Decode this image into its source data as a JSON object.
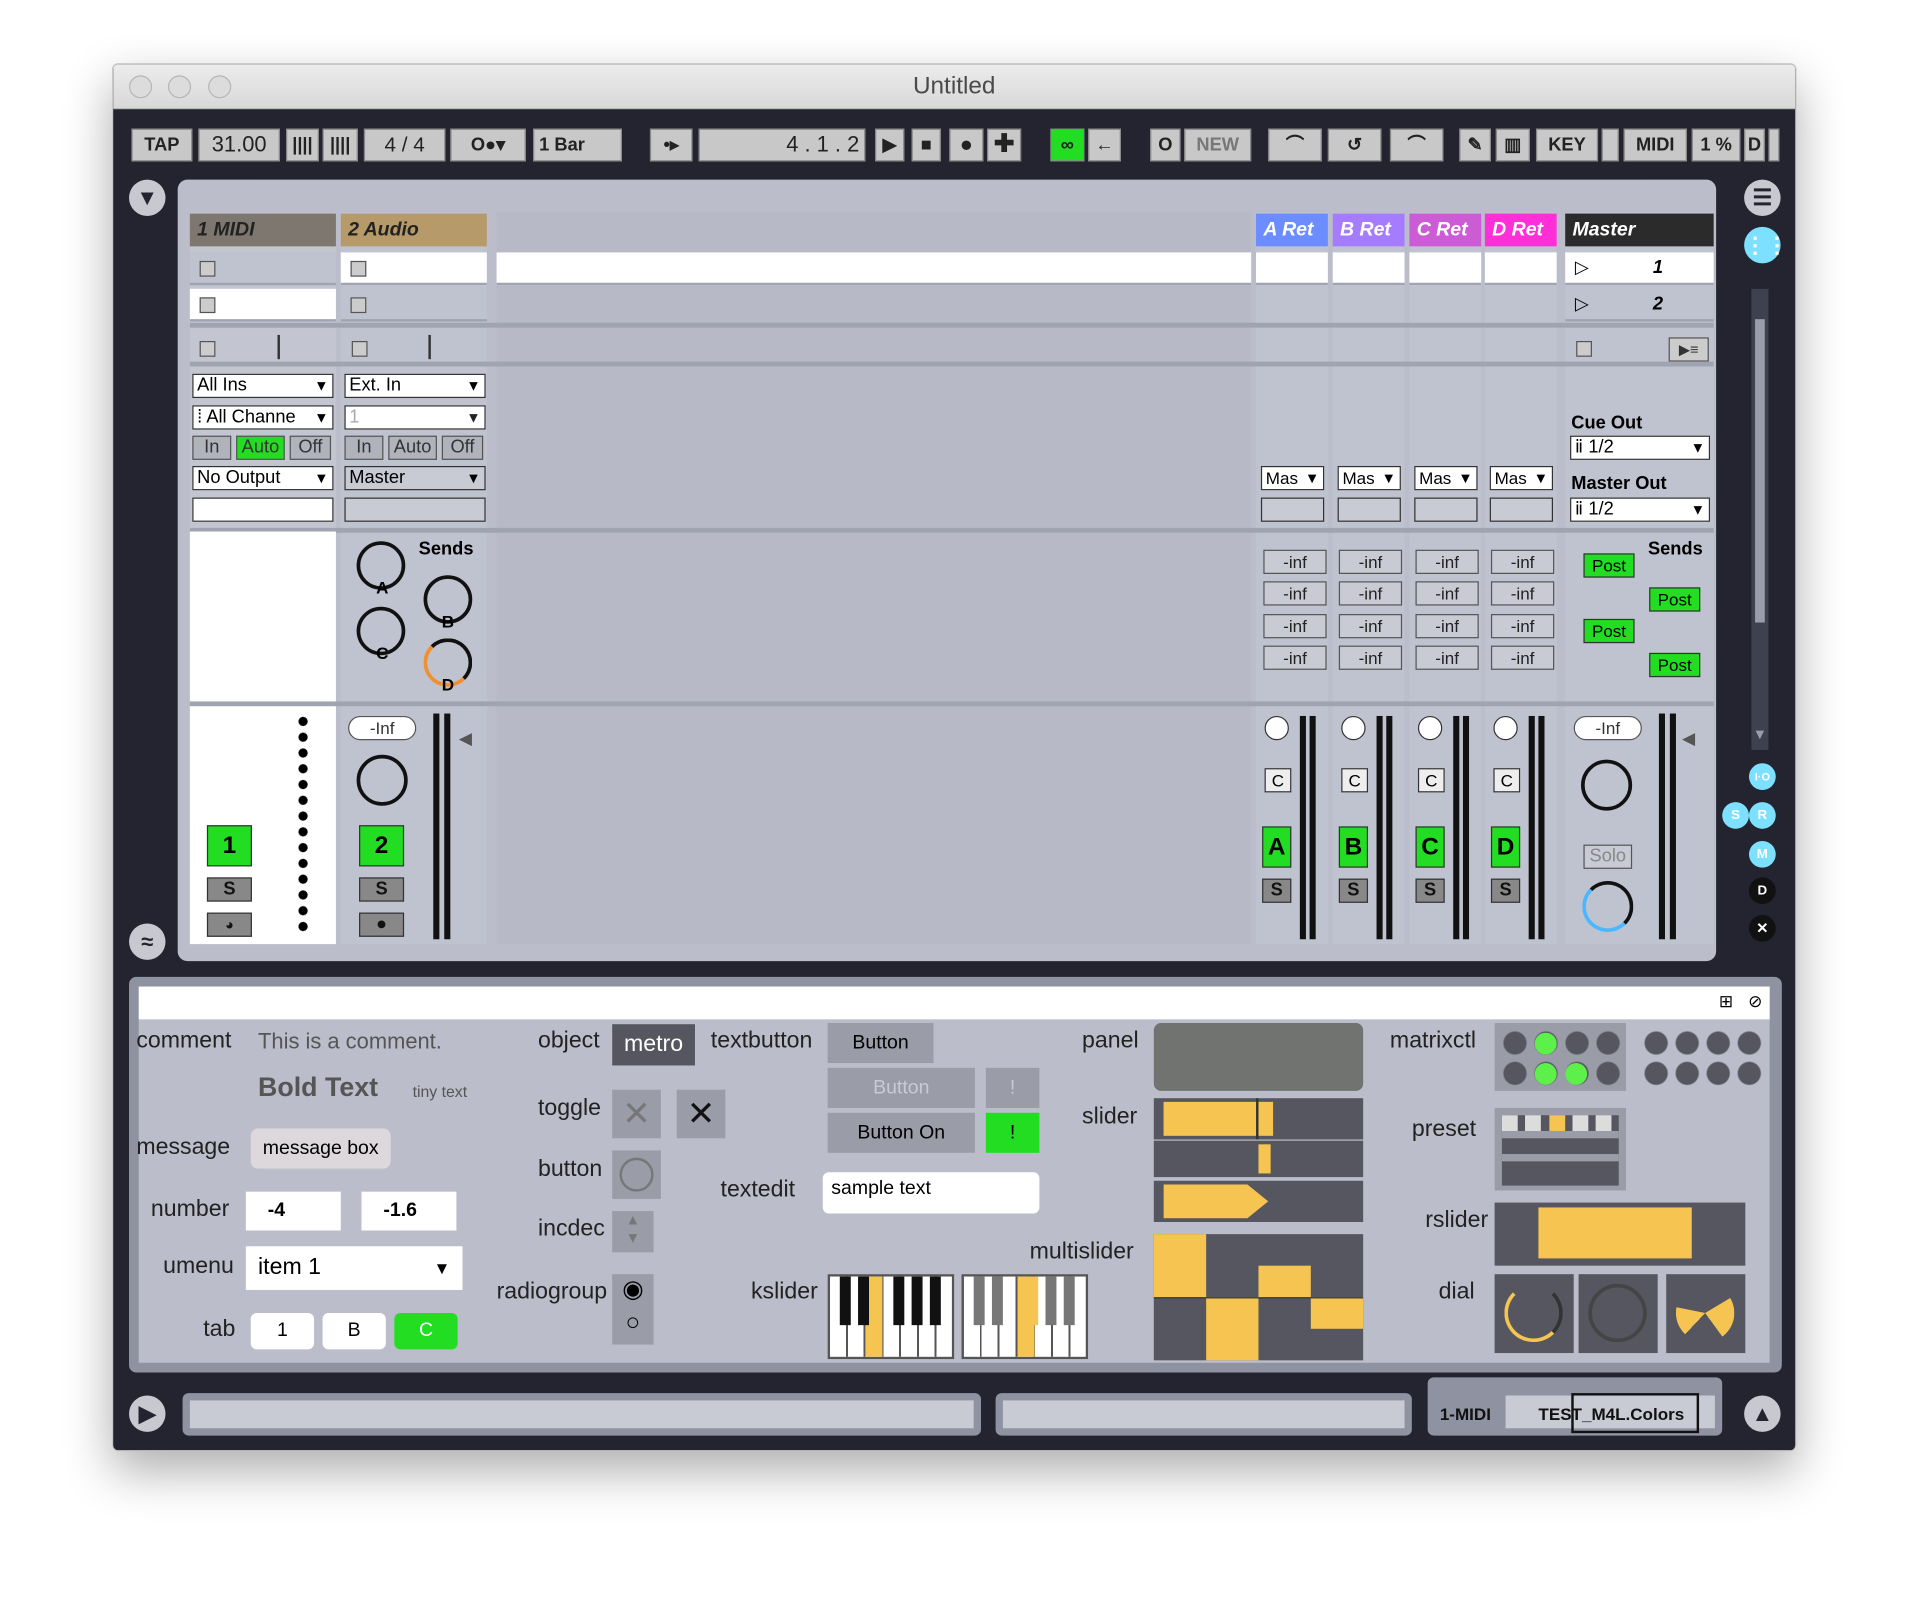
{
  "window": {
    "title": "Untitled"
  },
  "transport": {
    "tap": "TAP",
    "tempo": "31.00",
    "meter": "4 / 4",
    "quant": "1 Bar",
    "pos": "4 . 1 . 2",
    "new": "NEW",
    "key": "KEY",
    "midi": "MIDI",
    "cpu": "1 %",
    "d": "D"
  },
  "tracks": {
    "midi": "1 MIDI",
    "audio": "2 Audio",
    "retA": "A Ret",
    "retB": "B Ret",
    "retC": "C Ret",
    "retD": "D Ret",
    "master": "Master"
  },
  "colors": {
    "midi": "#7d7770",
    "audio": "#b79a6a",
    "retA": "#6b8dff",
    "retB": "#a67cff",
    "retC": "#cc5cd6",
    "retD": "#ff2fd8",
    "accent": "#22dd22",
    "yellow": "#f5c451"
  },
  "scenes": [
    "1",
    "2"
  ],
  "io": {
    "allIns": "All Ins",
    "allCh": "All Channe",
    "extIn": "Ext. In",
    "one": "1",
    "in": "In",
    "auto": "Auto",
    "off": "Off",
    "noOut": "No Output",
    "master": "Master",
    "mas": "Mas",
    "cueOut": "Cue Out",
    "cueVal": "1/2",
    "masterOut": "Master Out",
    "masterVal": "1/2"
  },
  "mixer": {
    "sends": "Sends",
    "inf": "-inf",
    "Inf": "-Inf",
    "post": "Post",
    "solo": "Solo",
    "s": "S",
    "c": "C",
    "knobA": "A",
    "knobB": "B",
    "knobC": "C",
    "knobD": "D",
    "t1": "1",
    "t2": "2",
    "tA": "A",
    "tB": "B",
    "tC": "C",
    "tD": "D"
  },
  "device": {
    "comment": "comment",
    "commentText": "This is a comment.",
    "bold": "Bold Text",
    "tiny": "tiny text",
    "message": "message",
    "msgBox": "message box",
    "number": "number",
    "n1": "-4",
    "n2": "-1.6",
    "umenu": "umenu",
    "item": "item 1",
    "tab": "tab",
    "tab1": "1",
    "tabB": "B",
    "tabC": "C",
    "object": "object",
    "metro": "metro",
    "toggle": "toggle",
    "button": "button",
    "incdec": "incdec",
    "radiogroup": "radiogroup",
    "textbutton": "textbutton",
    "btn": "Button",
    "btnOn": "Button On",
    "excl": "!",
    "textedit": "textedit",
    "sample": "sample text",
    "kslider": "kslider",
    "panel": "panel",
    "slider": "slider",
    "multislider": "multislider",
    "matrixctl": "matrixctl",
    "preset": "preset",
    "rslider": "rslider",
    "dial": "dial"
  },
  "bottom": {
    "track": "1-MIDI",
    "device": "TEST_M4L.Colors"
  }
}
